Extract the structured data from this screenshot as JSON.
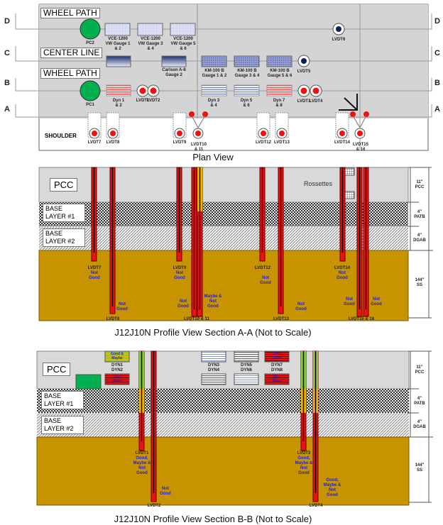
{
  "plan_view": {
    "title": "Plan View",
    "sections": [
      "D",
      "C",
      "B",
      "A"
    ],
    "zones": {
      "wheel_path_top": "WHEEL PATH",
      "center_line": "CENTER LINE",
      "wheel_path_bottom": "WHEEL PATH",
      "shoulder": "SHOULDER"
    },
    "sensors": {
      "pc2": "PC2",
      "vce1": "VCE-1200\nVW Gauge 1\n& 2",
      "vce3": "VCE-1200\nVW Gauge 3\n& 4",
      "vce5": "VCE-1200\nVW Gauge 5\n& 6",
      "lvdt6": "LVDT6",
      "carlson": "Carlson A-8\nGauge 2",
      "km1": "KM-100 B\nGauge 1 & 2",
      "km3": "KM-100 B\nGauge 3 & 4",
      "km5": "KM-100 B\nGauge 5 & 6",
      "lvdt5": "LVDT5",
      "pc1": "PC1",
      "dyn1": "Dyn 1\n& 2",
      "lvdt1": "LVDT1",
      "lvdt2": "LVDT2",
      "dyn3": "Dyn 3\n& 4",
      "dyn5": "Dyn 5\n& 6",
      "dyn7": "Dyn 7\n& 8",
      "lvdt3": "LVDT3",
      "lvdt4": "LVDT4",
      "lvdt7": "LVDT7",
      "lvdt8": "LVDT8",
      "lvdt9": "LVDT9",
      "lvdt10": "LVDT10\n& 11",
      "lvdt12": "LVDT12",
      "lvdt13": "LVDT13",
      "lvdt14": "LVDT14",
      "lvdt15": "LVDT15\n& 16"
    }
  },
  "layers": {
    "pcc": "PCC",
    "base1": "BASE\nLAYER #1",
    "base2": "BASE\nLAYER #2",
    "dims": [
      {
        "value": "11\"",
        "name": "PCC"
      },
      {
        "value": "4\"",
        "name": "PATB"
      },
      {
        "value": "4\"",
        "name": "DGAB"
      },
      {
        "value": "144\"",
        "name": "SS"
      }
    ]
  },
  "profile_aa": {
    "title": "J12J10N Profile View Section A-A (Not to Scale)",
    "rossettes": "Rossettes",
    "labels": {
      "lvdt7": "LVDT7",
      "lvdt7_status": "Not\nGood",
      "lvdt8": "LVDT8",
      "lvdt8_status": "Not\nGood",
      "lvdt9": "LVDT9",
      "lvdt9_status": "Not\nGood",
      "lvdt10": "LVDT10 & 11",
      "lvdt10_status": "Not\nGood",
      "lvdt11_status": "Maybe &\nNot\nGood",
      "lvdt12": "LVDT12",
      "lvdt12_status": "Not\nGood",
      "lvdt13": "LVDT13",
      "lvdt13_status": "Not\nGood",
      "lvdt14": "LVDT14",
      "lvdt14_status": "Not\nGood",
      "lvdt15": "LVDT15 & 16",
      "lvdt15_status": "Not\nGood",
      "lvdt16_status": "Not\nGood"
    }
  },
  "profile_bb": {
    "title": "J12J10N Profile View Section B-B (Not to Scale)",
    "labels": {
      "dyn12": "DYN1\nDYN2",
      "dyn1_status": "Good &\nMaybe",
      "dyn2_status": "Not\nGood",
      "dyn34": "DYN3\nDYN4",
      "dyn56": "DYN5\nDYN6",
      "dyn78": "DYN7\nDYN8",
      "dyn7_status": "Not\nGood",
      "dyn8_status": "Not\nGood",
      "lvdt1": "LVDT1",
      "lvdt1_status": "Good,\nMaybe &\nNot\nGood",
      "lvdt2": "LVDT2",
      "lvdt2_status": "Not\nGood",
      "lvdt3": "LVDT3",
      "lvdt3_status": "Good,\nMaybe &\nNot\nGood",
      "lvdt4": "LVDT4",
      "lvdt4_status": "Good,\nMaybe &\nNot\nGood"
    }
  },
  "colors": {
    "pcc": "#d9d9d9",
    "subgrade": "#c79400",
    "sensor_red": "#ee1111",
    "good_green": "#8dc63f",
    "maybe_yellow": "#f0b400",
    "status_blue": "#2020e0",
    "pc_green": "#00b050"
  }
}
